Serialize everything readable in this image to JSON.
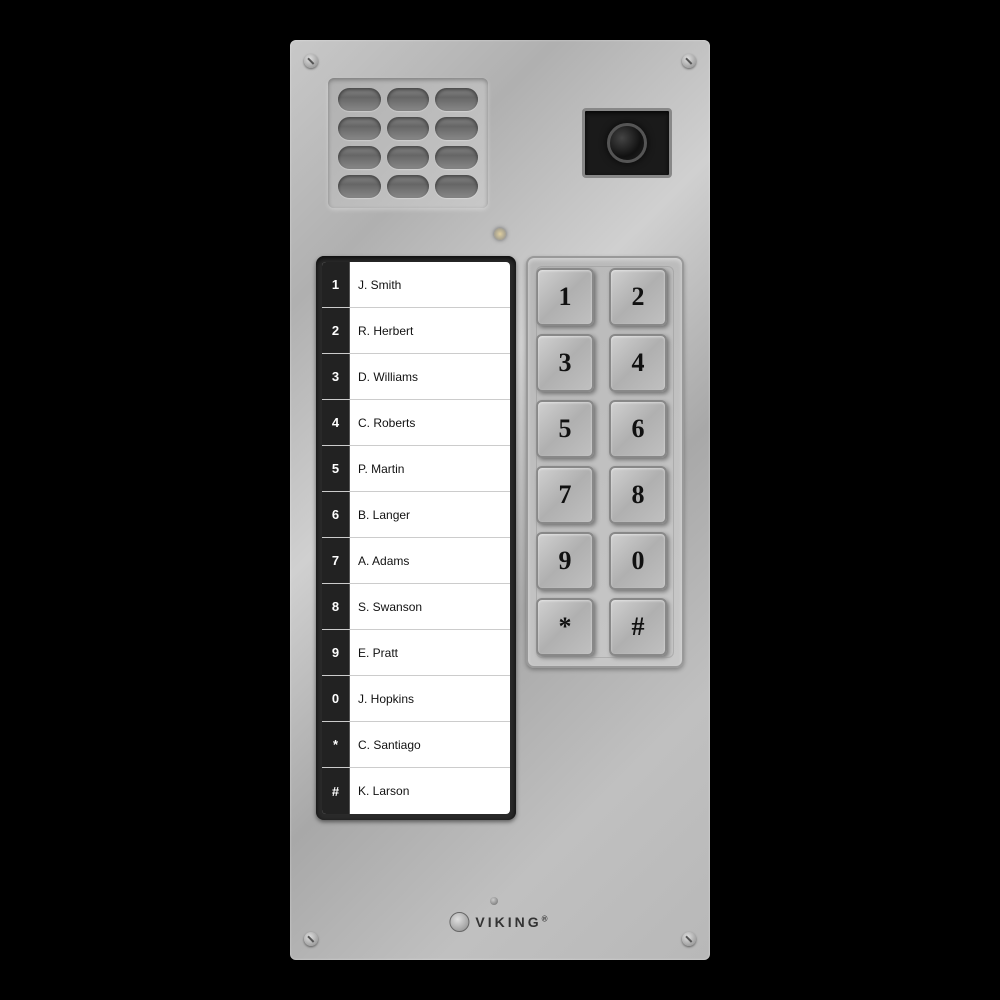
{
  "brand": {
    "name": "VIKING",
    "registered": "®"
  },
  "directory": {
    "rows": [
      {
        "number": "1",
        "name": "J. Smith"
      },
      {
        "number": "2",
        "name": "R. Herbert"
      },
      {
        "number": "3",
        "name": "D. Williams"
      },
      {
        "number": "4",
        "name": "C. Roberts"
      },
      {
        "number": "5",
        "name": "P. Martin"
      },
      {
        "number": "6",
        "name": "B. Langer"
      },
      {
        "number": "7",
        "name": "A. Adams"
      },
      {
        "number": "8",
        "name": "S. Swanson"
      },
      {
        "number": "9",
        "name": "E. Pratt"
      },
      {
        "number": "0",
        "name": "J. Hopkins"
      },
      {
        "number": "*",
        "name": "C. Santiago"
      },
      {
        "number": "#",
        "name": "K. Larson"
      }
    ]
  },
  "keypad": {
    "keys": [
      "1",
      "2",
      "3",
      "4",
      "5",
      "6",
      "7",
      "8",
      "9",
      "0",
      "*",
      "#"
    ]
  }
}
